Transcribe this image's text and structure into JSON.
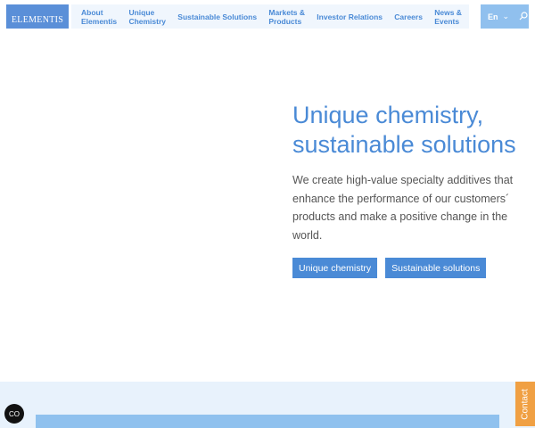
{
  "logo": "ELEMENTIS",
  "nav": [
    {
      "l1": "About",
      "l2": "Elementis"
    },
    {
      "l1": "Unique",
      "l2": "Chemistry"
    },
    {
      "l1": "Sustainable Solutions",
      "l2": ""
    },
    {
      "l1": "Markets &",
      "l2": "Products"
    },
    {
      "l1": "Investor Relations",
      "l2": ""
    },
    {
      "l1": "Careers",
      "l2": ""
    },
    {
      "l1": "News &",
      "l2": "Events"
    }
  ],
  "lang": "En",
  "hero": {
    "title": "Unique chemistry, sustainable solutions",
    "text": "We create high-value specialty additives that enhance the performance of our customers´ products and make a positive change in the world.",
    "btn1": "Unique chemistry",
    "btn2": "Sustainable solutions"
  },
  "cookie": "CO",
  "contact": "Contact"
}
